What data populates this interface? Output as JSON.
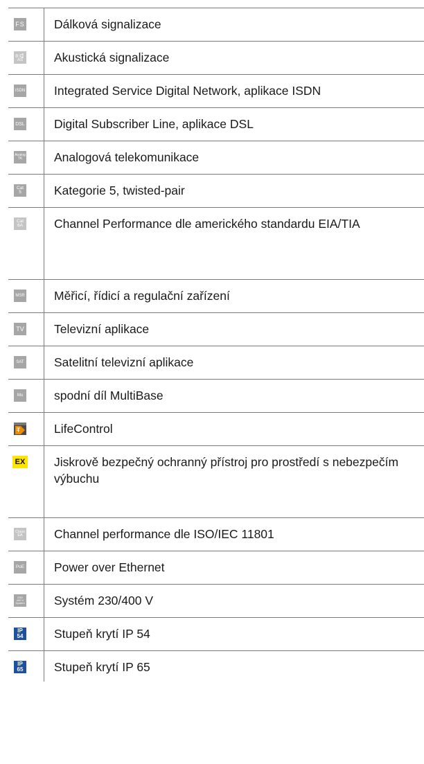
{
  "rows": [
    {
      "icon": "fs-icon",
      "badge": [
        "FS"
      ],
      "text": "Dálková signalizace"
    },
    {
      "icon": "acoustic-signal-icon",
      "badge": [
        "AS"
      ],
      "text": "Akustická signalizace"
    },
    {
      "icon": "isdn-icon",
      "badge": [
        "ISDN"
      ],
      "text": "Integrated Service Digital Network, aplikace ISDN"
    },
    {
      "icon": "dsl-icon",
      "badge": [
        "DSL"
      ],
      "text": "Digital Subscriber Line, aplikace DSL"
    },
    {
      "icon": "analog-tk-icon",
      "badge": [
        "Analog",
        "TK"
      ],
      "text": "Analogová telekomunikace"
    },
    {
      "icon": "cat5-icon",
      "badge": [
        "Cat",
        "5"
      ],
      "text": "Kategorie 5, twisted-pair"
    },
    {
      "icon": "cat6a-icon",
      "badge": [
        "Cat",
        "6A"
      ],
      "text": "Channel Performance dle amerického standardu EIA/TIA"
    },
    {
      "icon": "msr-icon",
      "badge": [
        "MSR"
      ],
      "text": "Měřicí, řídicí a regulační zařízení"
    },
    {
      "icon": "tv-icon",
      "badge": [
        "TV"
      ],
      "text": "Televizní aplikace"
    },
    {
      "icon": "sat-icon",
      "badge": [
        "SAT"
      ],
      "text": "Satelitní televizní aplikace"
    },
    {
      "icon": "multibase-icon",
      "badge": [
        "Mu"
      ],
      "text": "spodní díl MultiBase"
    },
    {
      "icon": "lifecontrol-icon",
      "badge": [
        "Life Control"
      ],
      "text": "LifeControl"
    },
    {
      "icon": "ex-icon",
      "badge": [
        "EX"
      ],
      "text": "Jiskrově bezpečný ochranný přístroj pro prostředí s nebezpečím výbuchu"
    },
    {
      "icon": "class-ea-icon",
      "badge": [
        "Class",
        "EA"
      ],
      "text": "Channel performance dle ISO/IEC 11801"
    },
    {
      "icon": "poe-icon",
      "badge": [
        "PoE"
      ],
      "text": "Power over Ethernet"
    },
    {
      "icon": "system-230-400-icon",
      "badge": [
        "230/",
        "400 V",
        "System"
      ],
      "text": "Systém 230/400 V"
    },
    {
      "icon": "ip54-icon",
      "badge": [
        "IP",
        "54"
      ],
      "text": "Stupeň krytí IP 54"
    },
    {
      "icon": "ip65-icon",
      "badge": [
        "IP",
        "65"
      ],
      "text": "Stupeň krytí IP 65"
    }
  ]
}
